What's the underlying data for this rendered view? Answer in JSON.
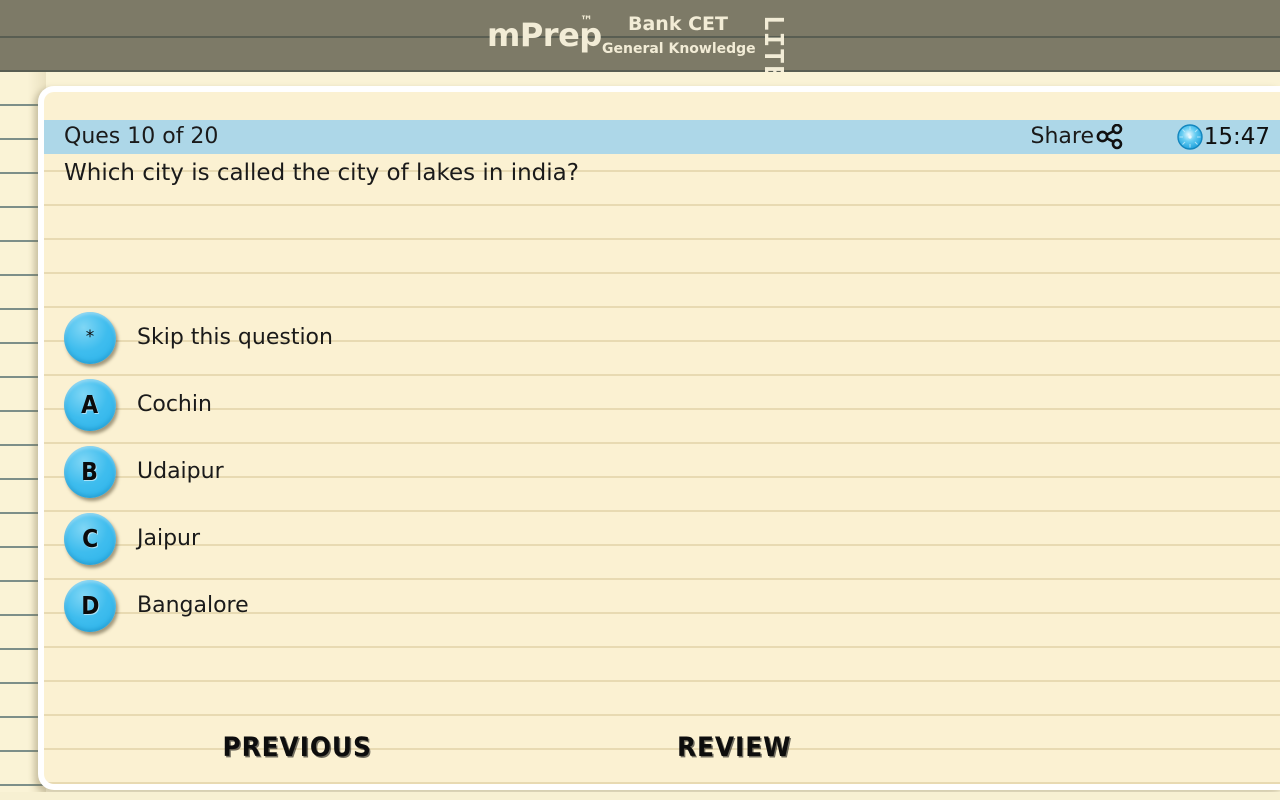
{
  "header": {
    "brand": "mPrep",
    "trademark": "™",
    "exam_title": "Bank CET",
    "exam_subject": "General Knowledge",
    "edition_badge": "LITE",
    "bar_color": "#7D7A67",
    "text_color": "#F2ECD6"
  },
  "quiz": {
    "status_bar": {
      "question_counter": "Ques 10 of 20",
      "share_label": "Share",
      "share_icon": "share-icon",
      "timer_icon": "clock-icon",
      "timer_value": "15:47",
      "bar_color": "#ADD7E8"
    },
    "question_text": "Which city is called the city of lakes in india?",
    "options": [
      {
        "key": "*",
        "icon": "asterisk-icon",
        "label": "Skip this question"
      },
      {
        "key": "A",
        "icon": "letter-a-icon",
        "label": "Cochin"
      },
      {
        "key": "B",
        "icon": "letter-b-icon",
        "label": "Udaipur"
      },
      {
        "key": "C",
        "icon": "letter-c-icon",
        "label": "Jaipur"
      },
      {
        "key": "D",
        "icon": "letter-d-icon",
        "label": "Bangalore"
      }
    ],
    "footer": {
      "previous_label": "PREVIOUS",
      "review_label": "REVIEW"
    }
  },
  "theme": {
    "paper_bg": "#FAF3D6",
    "paper_rule": "#7D8F89",
    "card_bg": "#FBF1D2",
    "card_border": "#FFFFFF",
    "option_blue": "#3FBDEE"
  }
}
